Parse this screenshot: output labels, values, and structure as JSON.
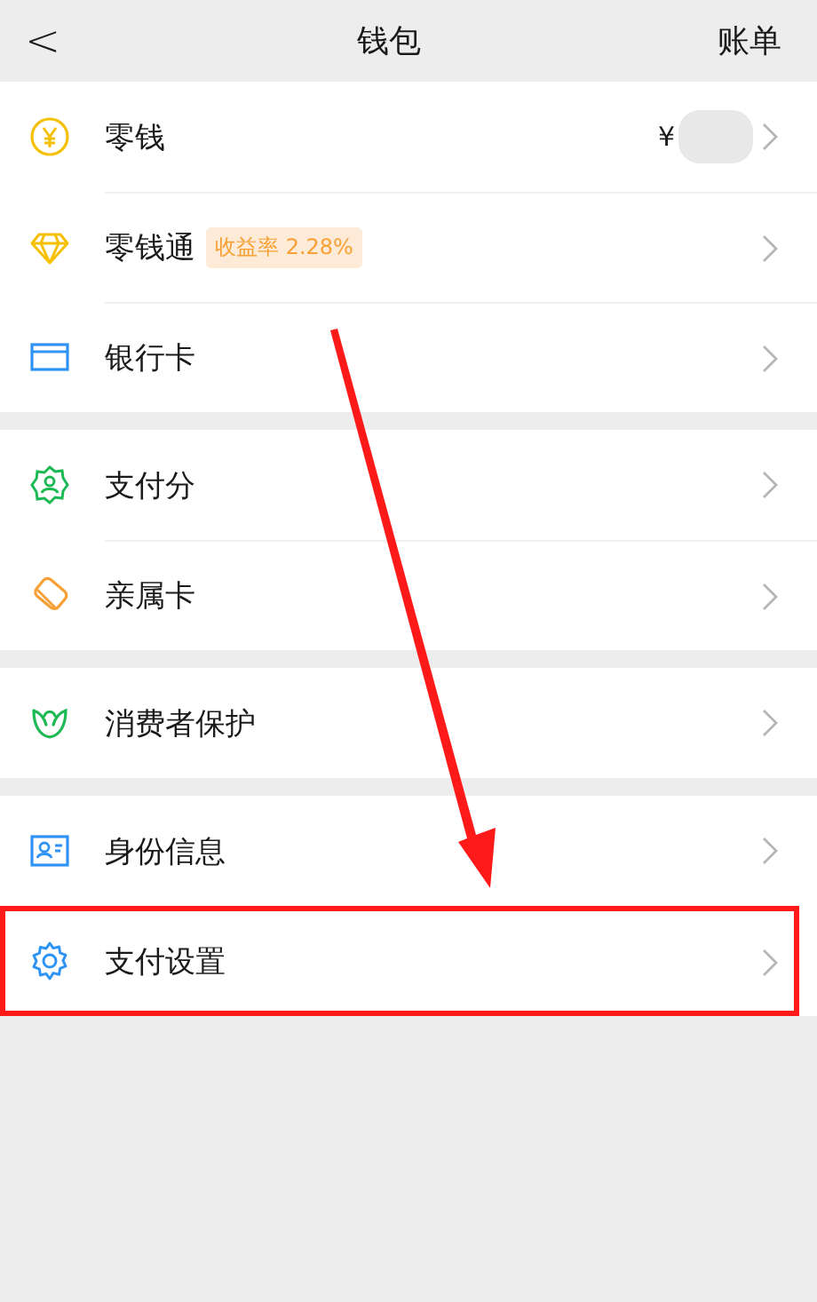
{
  "header": {
    "back": "<",
    "title": "钱包",
    "action": "账单"
  },
  "groups": [
    {
      "items": [
        {
          "label": "零钱",
          "value": "¥",
          "redacted": true,
          "highlighted": false
        },
        {
          "label": "零钱通",
          "badge": "收益率 2.28%",
          "highlighted": false
        },
        {
          "label": "银行卡",
          "highlighted": false
        }
      ]
    },
    {
      "items": [
        {
          "label": "支付分",
          "highlighted": false
        },
        {
          "label": "亲属卡",
          "highlighted": false
        }
      ]
    },
    {
      "items": [
        {
          "label": "消费者保护",
          "highlighted": false
        }
      ]
    },
    {
      "items": [
        {
          "label": "身份信息",
          "highlighted": false
        },
        {
          "label": "支付设置",
          "highlighted": true
        }
      ]
    }
  ]
}
